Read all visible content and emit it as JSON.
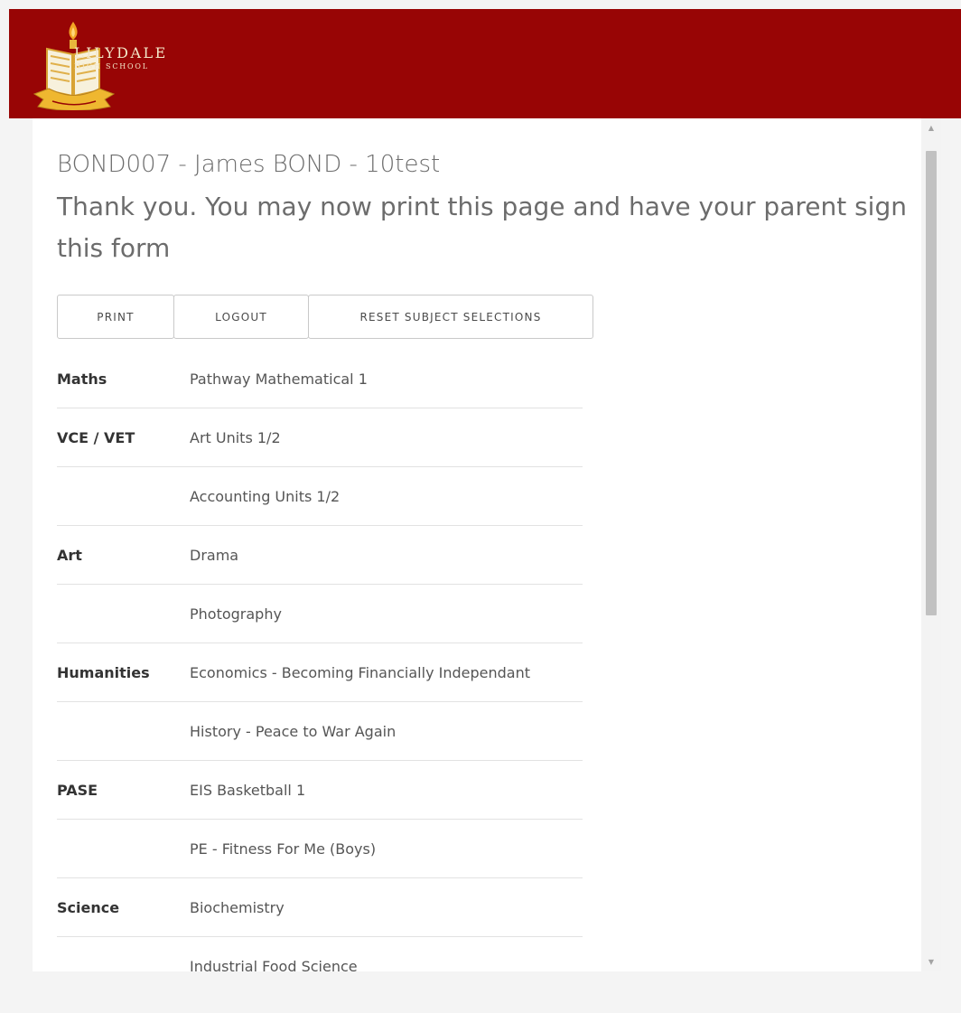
{
  "header": {
    "school_name": "LILYDALE",
    "school_sub": "HIGH SCHOOL",
    "brand_color": "#980505",
    "logo_icon": "school-crest-book-torch"
  },
  "page": {
    "title": "BOND007 - James BOND - 10test",
    "subtitle": "Thank you. You may now print this page and have your parent sign this form"
  },
  "buttons": {
    "print": "PRINT",
    "logout": "LOGOUT",
    "reset": "RESET SUBJECT SELECTIONS"
  },
  "selections": [
    {
      "category": "Maths",
      "subject": "Pathway Mathematical 1"
    },
    {
      "category": "VCE / VET",
      "subject": "Art Units 1/2"
    },
    {
      "category": "",
      "subject": "Accounting Units 1/2"
    },
    {
      "category": "Art",
      "subject": "Drama"
    },
    {
      "category": "",
      "subject": "Photography"
    },
    {
      "category": "Humanities",
      "subject": "Economics - Becoming Financially Independant"
    },
    {
      "category": "",
      "subject": "History - Peace to War Again"
    },
    {
      "category": "PASE",
      "subject": "EIS Basketball 1"
    },
    {
      "category": "",
      "subject": "PE - Fitness For Me (Boys)"
    },
    {
      "category": "Science",
      "subject": "Biochemistry"
    },
    {
      "category": "",
      "subject": "Industrial Food Science"
    }
  ]
}
